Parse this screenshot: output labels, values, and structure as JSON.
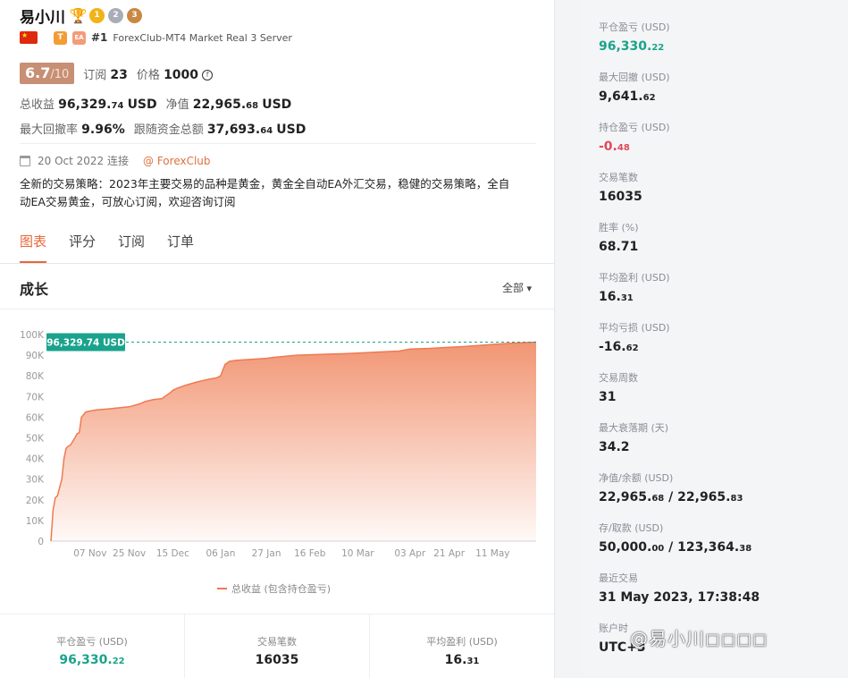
{
  "profile": {
    "name": "易小川",
    "medals": [
      "1",
      "2",
      "3"
    ],
    "tag_t": "T",
    "tag_ea": "EA",
    "rank": "#1",
    "server": "ForexClub-MT4 Market Real 3 Server",
    "score": "6.7",
    "score_max": "/10",
    "subscribe_label": "订阅",
    "subscribe_count": "23",
    "price_label": "价格",
    "price_value": "1000",
    "total_profit_label": "总收益",
    "total_profit_main": "96,329.",
    "total_profit_dec": "74",
    "total_profit_unit": "USD",
    "equity_label": "净值",
    "equity_main": "22,965.",
    "equity_dec": "68",
    "equity_unit": "USD",
    "max_drawdown_label": "最大回撤率",
    "max_drawdown_value": "9.96%",
    "follow_funds_label": "跟随资金总额",
    "follow_funds_main": "37,693.",
    "follow_funds_dec": "64",
    "follow_funds_unit": "USD",
    "connected": "20 Oct 2022 连接",
    "broker_link": "@ ForexClub",
    "description": "全新的交易策略：2023年主要交易的品种是黄金，黄金全自动EA外汇交易，稳健的交易策略，全自动EA交易黄金，可放心订阅，欢迎咨询订阅"
  },
  "tabs": [
    "图表",
    "评分",
    "订阅",
    "订单"
  ],
  "growth": {
    "title": "成长",
    "range": "全部"
  },
  "chart_data": {
    "type": "area",
    "x_ticks": [
      "07 Nov",
      "25 Nov",
      "15 Dec",
      "06 Jan",
      "27 Jan",
      "16 Feb",
      "10 Mar",
      "03 Apr",
      "21 Apr",
      "11 May"
    ],
    "y_ticks": [
      "0",
      "10K",
      "20K",
      "30K",
      "40K",
      "50K",
      "60K",
      "70K",
      "80K",
      "90K",
      "100K"
    ],
    "ylim": [
      0,
      100000
    ],
    "xlim": [
      "2022-10-20",
      "2023-05-31"
    ],
    "latest_label": "96,329.74 USD",
    "latest_value": 96329.74,
    "legend": "总收益 (包含持仓盈亏)",
    "color": "#f08a64",
    "x_dates": [
      "2022-10-20",
      "2022-10-21",
      "2022-10-22",
      "2022-10-23",
      "2022-10-25",
      "2022-10-26",
      "2022-10-27",
      "2022-10-28",
      "2022-10-29",
      "2022-10-31",
      "2022-11-01",
      "2022-11-02",
      "2022-11-03",
      "2022-11-05",
      "2022-11-07",
      "2022-11-10",
      "2022-11-15",
      "2022-11-20",
      "2022-11-25",
      "2022-11-30",
      "2022-12-02",
      "2022-12-06",
      "2022-12-10",
      "2022-12-14",
      "2022-12-15",
      "2022-12-17",
      "2022-12-21",
      "2022-12-26",
      "2023-01-01",
      "2023-01-04",
      "2023-01-06",
      "2023-01-08",
      "2023-01-10",
      "2023-01-13",
      "2023-01-20",
      "2023-01-27",
      "2023-01-31",
      "2023-02-10",
      "2023-02-16",
      "2023-02-25",
      "2023-03-03",
      "2023-03-10",
      "2023-03-19",
      "2023-03-29",
      "2023-04-03",
      "2023-04-12",
      "2023-04-21",
      "2023-04-28",
      "2023-05-08",
      "2023-05-15",
      "2023-05-24",
      "2023-05-31"
    ],
    "values": [
      0,
      15000,
      21000,
      22000,
      30000,
      40000,
      45000,
      46000,
      46500,
      50000,
      52000,
      52500,
      60000,
      62500,
      63000,
      63500,
      64000,
      64500,
      65000,
      66500,
      67500,
      68500,
      69000,
      72000,
      73000,
      74000,
      75500,
      77000,
      78500,
      79000,
      80000,
      85500,
      87000,
      87500,
      88000,
      88500,
      89000,
      90000,
      90200,
      90500,
      90700,
      91000,
      91500,
      92000,
      93000,
      93300,
      93800,
      94200,
      95000,
      95500,
      96000,
      96329.74
    ]
  },
  "bottom_stats": [
    {
      "label": "平仓盈亏 (USD)",
      "main": "96,330.",
      "dec": "22"
    },
    {
      "label": "交易笔数",
      "main": "16035",
      "dec": ""
    },
    {
      "label": "平均盈利 (USD)",
      "main": "16.",
      "dec": "31"
    }
  ],
  "side_stats": [
    {
      "label": "平仓盈亏 (USD)",
      "main": "96,330.",
      "dec": "22",
      "tone": "green"
    },
    {
      "label": "最大回撤 (USD)",
      "main": "9,641.",
      "dec": "62",
      "tone": ""
    },
    {
      "label": "持仓盈亏 (USD)",
      "main": "-0.",
      "dec": "48",
      "tone": "red"
    },
    {
      "label": "交易笔数",
      "main": "16035",
      "dec": "",
      "tone": ""
    },
    {
      "label": "胜率 (%)",
      "main": "68.71",
      "dec": "",
      "tone": ""
    },
    {
      "label": "平均盈利 (USD)",
      "main": "16.",
      "dec": "31",
      "tone": ""
    },
    {
      "label": "平均亏损 (USD)",
      "main": "-16.",
      "dec": "62",
      "tone": ""
    },
    {
      "label": "交易周数",
      "main": "31",
      "dec": "",
      "tone": ""
    },
    {
      "label": "最大衰落期 (天)",
      "main": "34.2",
      "dec": "",
      "tone": ""
    },
    {
      "label": "净值/余额 (USD)",
      "main": "22,965.",
      "dec": "68",
      "main2": "22,965.",
      "dec2": "83",
      "tone": ""
    },
    {
      "label": "存/取款 (USD)",
      "main": "50,000.",
      "dec": "00",
      "main2": "123,364.",
      "dec2": "38",
      "tone": ""
    },
    {
      "label": "最近交易",
      "main": "31 May 2023, 17:38:48",
      "dec": "",
      "tone": ""
    },
    {
      "label": "账户时",
      "main": "UTC+3",
      "dec": "",
      "tone": ""
    }
  ],
  "watermark": "@易小川◻◻◻◻"
}
